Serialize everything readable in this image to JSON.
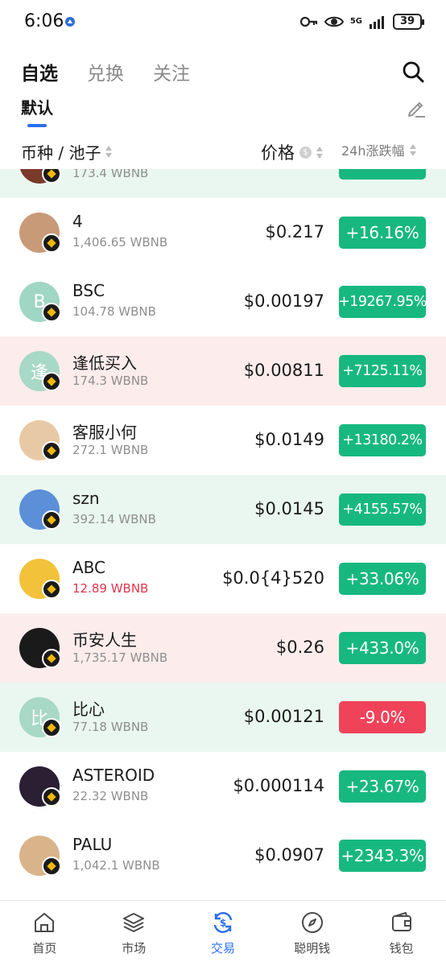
{
  "status_bar": {
    "time": "6:06",
    "network": "5G",
    "battery": "39"
  },
  "top_tabs": [
    {
      "label": "自选",
      "active": true
    },
    {
      "label": "兑换",
      "active": false
    },
    {
      "label": "关注",
      "active": false
    }
  ],
  "sub_tab": "默认",
  "columns": {
    "name": "币种 / 池子",
    "price": "价格",
    "change": "24h涨跌幅",
    "price_unit_icon": "$"
  },
  "rows": [
    {
      "name": "",
      "liquidity": "173.4 WBNB",
      "price": "",
      "change": "",
      "direction": "up",
      "bg": "green",
      "avatar_color": "#7a3b2a",
      "avatar_letter": ""
    },
    {
      "name": "4",
      "liquidity": "1,406.65 WBNB",
      "price": "$0.217",
      "change": "+16.16%",
      "direction": "up",
      "bg": "white",
      "avatar_color": "#c99a78",
      "avatar_letter": ""
    },
    {
      "name": "BSC",
      "liquidity": "104.78 WBNB",
      "price": "$0.00197",
      "change": "+19267.95%",
      "direction": "up",
      "bg": "white",
      "avatar_color": "#9fd6c4",
      "avatar_letter": "B"
    },
    {
      "name": "逢低买入",
      "liquidity": "174.3 WBNB",
      "price": "$0.00811",
      "change": "+7125.11%",
      "direction": "up",
      "bg": "red",
      "avatar_color": "#a8d8c6",
      "avatar_letter": "逢"
    },
    {
      "name": "客服小何",
      "liquidity": "272.1 WBNB",
      "price": "$0.0149",
      "change": "+13180.2%",
      "direction": "up",
      "bg": "white",
      "avatar_color": "#e8c9a6",
      "avatar_letter": ""
    },
    {
      "name": "szn",
      "liquidity": "392.14 WBNB",
      "price": "$0.0145",
      "change": "+4155.57%",
      "direction": "up",
      "bg": "green",
      "avatar_color": "#5b8fd8",
      "avatar_letter": ""
    },
    {
      "name": "ABC",
      "liquidity": "12.89 WBNB",
      "liquidity_red": true,
      "price": "$0.0{4}520",
      "change": "+33.06%",
      "direction": "up",
      "bg": "white",
      "avatar_color": "#f2c23a",
      "avatar_letter": ""
    },
    {
      "name": "币安人生",
      "liquidity": "1,735.17 WBNB",
      "price": "$0.26",
      "change": "+433.0%",
      "direction": "up",
      "bg": "red",
      "avatar_color": "#1a1a1a",
      "avatar_letter": ""
    },
    {
      "name": "比心",
      "liquidity": "77.18 WBNB",
      "price": "$0.00121",
      "change": "-9.0%",
      "direction": "down",
      "bg": "green",
      "avatar_color": "#a8d8c6",
      "avatar_letter": "比"
    },
    {
      "name": "ASTEROID",
      "liquidity": "22.32 WBNB",
      "price": "$0.000114",
      "change": "+23.67%",
      "direction": "up",
      "bg": "white",
      "avatar_color": "#2a1f33",
      "avatar_letter": ""
    },
    {
      "name": "PALU",
      "liquidity": "1,042.1 WBNB",
      "price": "$0.0907",
      "change": "+2343.3%",
      "direction": "up",
      "bg": "white",
      "avatar_color": "#d9b48a",
      "avatar_letter": ""
    }
  ],
  "bottom_nav": [
    {
      "label": "首页",
      "icon": "home-icon",
      "active": false
    },
    {
      "label": "市场",
      "icon": "layers-icon",
      "active": false
    },
    {
      "label": "交易",
      "icon": "swap-icon",
      "active": true
    },
    {
      "label": "聪明钱",
      "icon": "compass-icon",
      "active": false
    },
    {
      "label": "钱包",
      "icon": "wallet-icon",
      "active": false
    }
  ],
  "colors": {
    "up": "#17b880",
    "down": "#f0435a",
    "accent": "#2a6ff0",
    "row_green": "#eaf7f0",
    "row_red": "#fdecec"
  }
}
